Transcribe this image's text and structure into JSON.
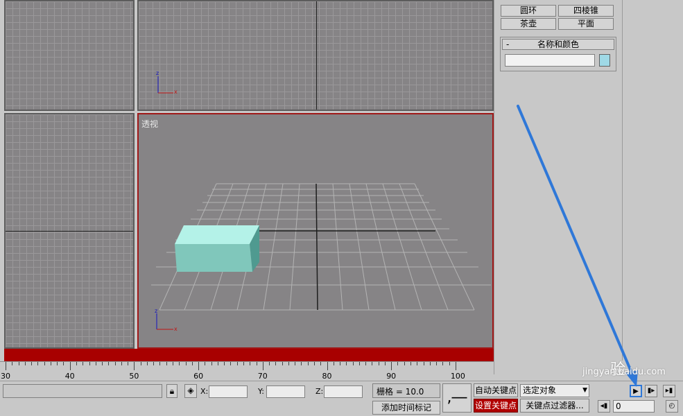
{
  "viewports": {
    "perspective_label": "透视",
    "axis_labels": {
      "z": "z",
      "x": "x"
    }
  },
  "command_panel": {
    "buttons": [
      {
        "label": "圆环"
      },
      {
        "label": "四棱锥"
      },
      {
        "label": "茶壶"
      },
      {
        "label": "平面"
      }
    ],
    "rollout": {
      "toggle": "-",
      "title": "名称和颜色",
      "name_value": ""
    }
  },
  "timeline": {
    "ticks": [
      "30",
      "40",
      "50",
      "60",
      "70",
      "80",
      "90",
      "100"
    ]
  },
  "status_bar": {
    "x_label": "X:",
    "y_label": "Y:",
    "z_label": "Z:",
    "grid_text": "栅格 = 10.0",
    "add_time_tag": "添加时间标记",
    "auto_key": "自动关键点",
    "set_key": "设置关键点",
    "selection_dropdown": "选定对象",
    "key_filters": "关键点过滤器...",
    "frame_value": "0"
  },
  "watermark": {
    "text": "jingyan.baidu.com",
    "badge": "验"
  },
  "colors": {
    "viewport_bg": "#868486",
    "active_border": "#a01818",
    "timeline_red": "#a80000",
    "box": "#9fe4da",
    "annotation_blue": "#2f78d8"
  }
}
